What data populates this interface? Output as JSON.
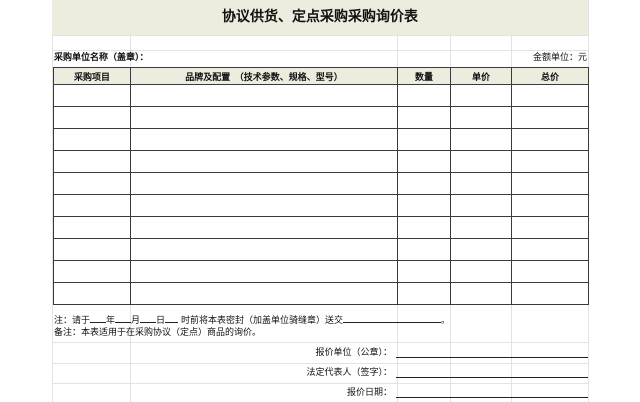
{
  "title": "协议供货、定点采购采购询价表",
  "unit_label": "采购单位名称（盖章）：",
  "currency_note": "金额单位：元",
  "columns": [
    "采购项目",
    "品牌及配置　（技术参数、规格、型号）",
    "数量",
    "单价",
    "总价"
  ],
  "row_count": 10,
  "note": {
    "prefix": "注：请于",
    "year": "年",
    "month": "月",
    "day": "日",
    "suffix": "时前将本表密封（加盖单位骑缝章）送交",
    "end": "。"
  },
  "remark": "备注：本表适用于在采购协议（定点）商品的询价。",
  "signatures": {
    "quote_unit": "报价单位（公章）：",
    "legal_rep": "法定代表人（签字）：",
    "quote_date": "报价日期："
  }
}
